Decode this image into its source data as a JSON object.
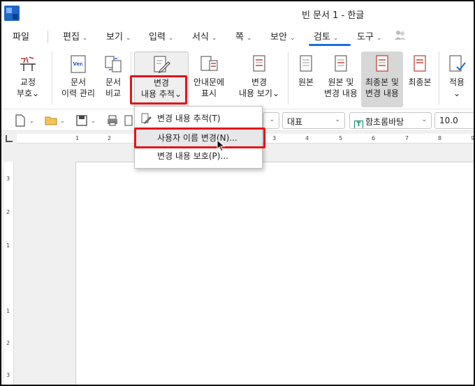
{
  "window": {
    "title": "빈 문서 1 - 한글"
  },
  "menu": {
    "items": [
      {
        "label": "파일",
        "chevron": false
      },
      {
        "label": "편집",
        "chevron": true
      },
      {
        "label": "보기",
        "chevron": true
      },
      {
        "label": "입력",
        "chevron": true
      },
      {
        "label": "서식",
        "chevron": true
      },
      {
        "label": "쪽",
        "chevron": true
      },
      {
        "label": "보안",
        "chevron": true
      },
      {
        "label": "검토",
        "chevron": true,
        "active": true
      },
      {
        "label": "도구",
        "chevron": true
      }
    ],
    "chevron_glyph": "⌄"
  },
  "ribbon": {
    "proof_marks": {
      "line1": "교정",
      "line2": "부호⌄"
    },
    "doc_history": {
      "badge": "Ver.",
      "line1": "문서",
      "line2": "이력 관리"
    },
    "doc_compare": {
      "line1": "문서",
      "line2": "비교"
    },
    "track_changes": {
      "line1": "변경",
      "line2": "내용 추적⌄"
    },
    "show_in_balloon": {
      "line1": "안내문에",
      "line2": "표시"
    },
    "view_changes": {
      "line1": "변경",
      "line2": "내용 보기⌄"
    },
    "original": {
      "line1": "원본",
      "line2": ""
    },
    "original_and_changes": {
      "line1": "원본 및",
      "line2": "변경 내용"
    },
    "final_and_changes": {
      "line1": "최종본 및",
      "line2": "변경 내용"
    },
    "final": {
      "line1": "최종본",
      "line2": ""
    },
    "apply": {
      "line1": "적용",
      "line2": "⌄"
    }
  },
  "toolbar": {
    "style_select": "대표",
    "font_select": "함초롬바탕",
    "font_badge": "T",
    "size_select": "10.0"
  },
  "dropdown": {
    "items": [
      {
        "label": "변경 내용 추적(T)"
      },
      {
        "label": "사용자 이름 변경(N)..."
      },
      {
        "label": "변경 내용 보호(P)..."
      }
    ]
  },
  "ruler": {
    "h_labels": [
      "1",
      "2",
      "1",
      "2",
      "3",
      "4",
      "5",
      "6",
      "7",
      "8",
      "9"
    ],
    "v_labels": [
      "3",
      "2",
      "1",
      "1",
      "2",
      "3",
      "4"
    ]
  },
  "colors": {
    "highlight_red": "#e4141b",
    "active_tab_blue": "#1b6fd6"
  }
}
